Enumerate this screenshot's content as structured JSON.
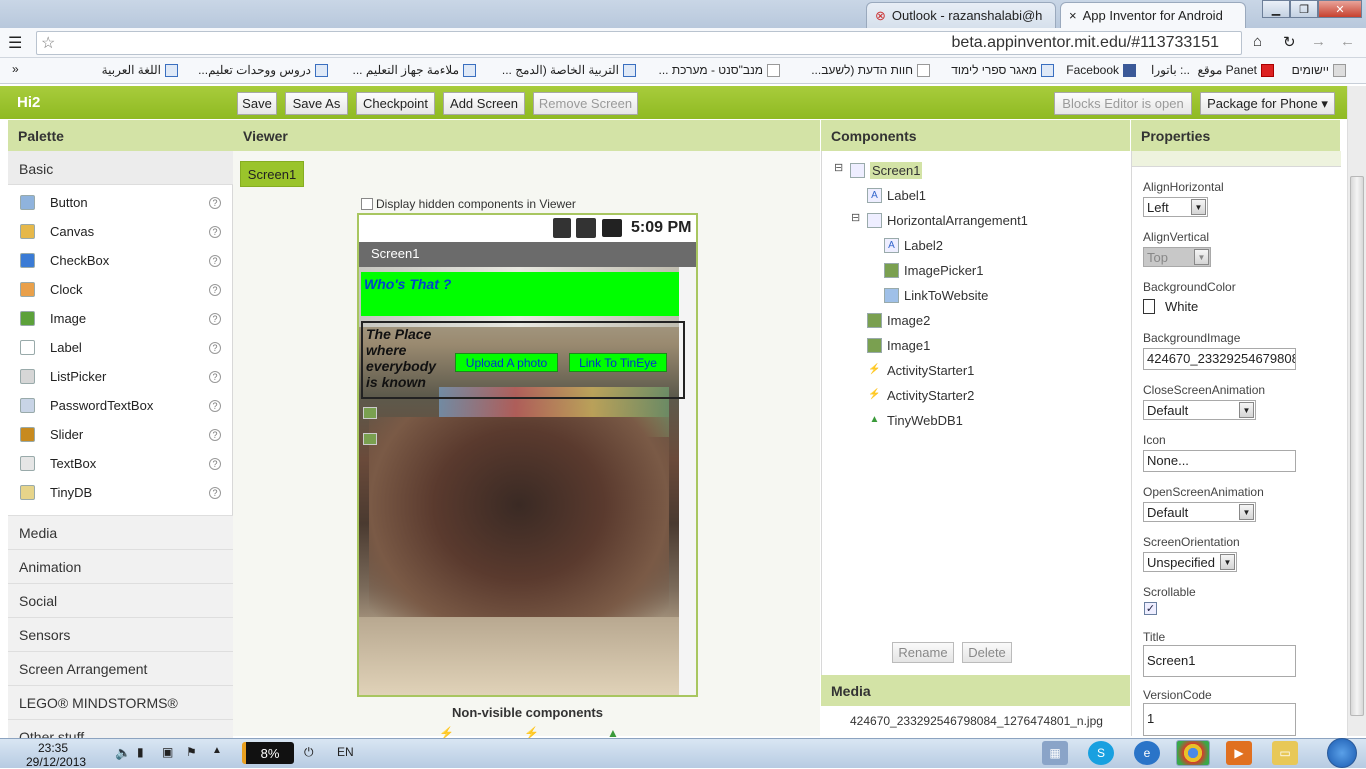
{
  "browser": {
    "tabs": [
      {
        "title": "Outlook - razanshalabi@h",
        "active": false
      },
      {
        "title": "App Inventor for Android",
        "active": true
      }
    ],
    "url": "beta.appinventor.mit.edu/#113733151",
    "bookmarks": [
      "יישומים",
      "Panet موقع",
      "..: باتورا",
      "Facebook",
      "מאגר ספרי לימוד",
      "חוות הדעת (לשעב...",
      "מנב\"סנט - מערכת ...",
      "التربية الخاصة (الدمج ...",
      "ملاءمة جهاز التعليم ...",
      "دروس ووحدات تعليم...",
      "اللغة العربية"
    ]
  },
  "header": {
    "project_name": "Hi2",
    "buttons": [
      "Save",
      "Save As",
      "Checkpoint",
      "Add Screen",
      "Remove Screen"
    ],
    "blocks_editor": "Blocks Editor is open",
    "package": "Package for Phone ▾"
  },
  "palette": {
    "title": "Palette",
    "section": "Basic",
    "items": [
      {
        "label": "Button",
        "icon": "button-icon",
        "color": "#8fb3dd"
      },
      {
        "label": "Canvas",
        "icon": "canvas-icon",
        "color": "#e6b84a"
      },
      {
        "label": "CheckBox",
        "icon": "checkbox-icon",
        "color": "#3a7bd5"
      },
      {
        "label": "Clock",
        "icon": "clock-icon",
        "color": "#e9a04a"
      },
      {
        "label": "Image",
        "icon": "image-icon",
        "color": "#5ca13a"
      },
      {
        "label": "Label",
        "icon": "label-icon",
        "color": "#ffffff"
      },
      {
        "label": "ListPicker",
        "icon": "listpicker-icon",
        "color": "#d6d6d6"
      },
      {
        "label": "PasswordTextBox",
        "icon": "password-icon",
        "color": "#c8d4e6"
      },
      {
        "label": "Slider",
        "icon": "slider-icon",
        "color": "#c78a1f"
      },
      {
        "label": "TextBox",
        "icon": "textbox-icon",
        "color": "#e6e6e6"
      },
      {
        "label": "TinyDB",
        "icon": "tinydb-icon",
        "color": "#e6d48a"
      }
    ],
    "drawers": [
      "Media",
      "Animation",
      "Social",
      "Sensors",
      "Screen Arrangement",
      "LEGO® MINDSTORMS®",
      "Other stuff"
    ]
  },
  "viewer": {
    "title": "Viewer",
    "screen_button": "Screen1",
    "hidden_checkbox": "Display hidden components in Viewer",
    "time": "5:09 PM",
    "screen_title": "Screen1",
    "label1": "Who's That ?",
    "label2": "The Place where everybody is known",
    "upload_button": "Upload A photo",
    "link_button": "Link To TinEye",
    "nonvisible": "Non-visible components"
  },
  "components": {
    "title": "Components",
    "tree": [
      {
        "label": "Screen1",
        "level": 0,
        "icon": "screen-icon",
        "toggle": "⊟"
      },
      {
        "label": "Label1",
        "level": 1,
        "icon": "label-icon"
      },
      {
        "label": "HorizontalArrangement1",
        "level": 1,
        "icon": "arrangement-icon",
        "toggle": "⊟"
      },
      {
        "label": "Label2",
        "level": 2,
        "icon": "label-icon"
      },
      {
        "label": "ImagePicker1",
        "level": 2,
        "icon": "imagepicker-icon"
      },
      {
        "label": "LinkToWebsite",
        "level": 2,
        "icon": "button-icon"
      },
      {
        "label": "Image2",
        "level": 1,
        "icon": "image-icon"
      },
      {
        "label": "Image1",
        "level": 1,
        "icon": "image-icon"
      },
      {
        "label": "ActivityStarter1",
        "level": 1,
        "icon": "lightning-icon"
      },
      {
        "label": "ActivityStarter2",
        "level": 1,
        "icon": "lightning-icon"
      },
      {
        "label": "TinyWebDB1",
        "level": 1,
        "icon": "arrow-up-icon"
      }
    ],
    "rename": "Rename",
    "delete": "Delete",
    "media_title": "Media",
    "media_file": "424670_233292546798084_1276474801_n.jpg"
  },
  "properties": {
    "title": "Properties",
    "align_horizontal": {
      "label": "AlignHorizontal",
      "value": "Left"
    },
    "align_vertical": {
      "label": "AlignVertical",
      "value": "Top"
    },
    "background_color": {
      "label": "BackgroundColor",
      "value": "White"
    },
    "background_image": {
      "label": "BackgroundImage",
      "value": "424670_23329254679808"
    },
    "close_anim": {
      "label": "CloseScreenAnimation",
      "value": "Default"
    },
    "icon": {
      "label": "Icon",
      "value": "None..."
    },
    "open_anim": {
      "label": "OpenScreenAnimation",
      "value": "Default"
    },
    "orientation": {
      "label": "ScreenOrientation",
      "value": "Unspecified"
    },
    "scrollable": {
      "label": "Scrollable",
      "checked": true
    },
    "title_prop": {
      "label": "Title",
      "value": "Screen1"
    },
    "version_code": {
      "label": "VersionCode",
      "value": "1"
    }
  },
  "taskbar": {
    "time": "23:35",
    "date": "29/12/2013",
    "battery": "8%",
    "lang": "EN"
  }
}
